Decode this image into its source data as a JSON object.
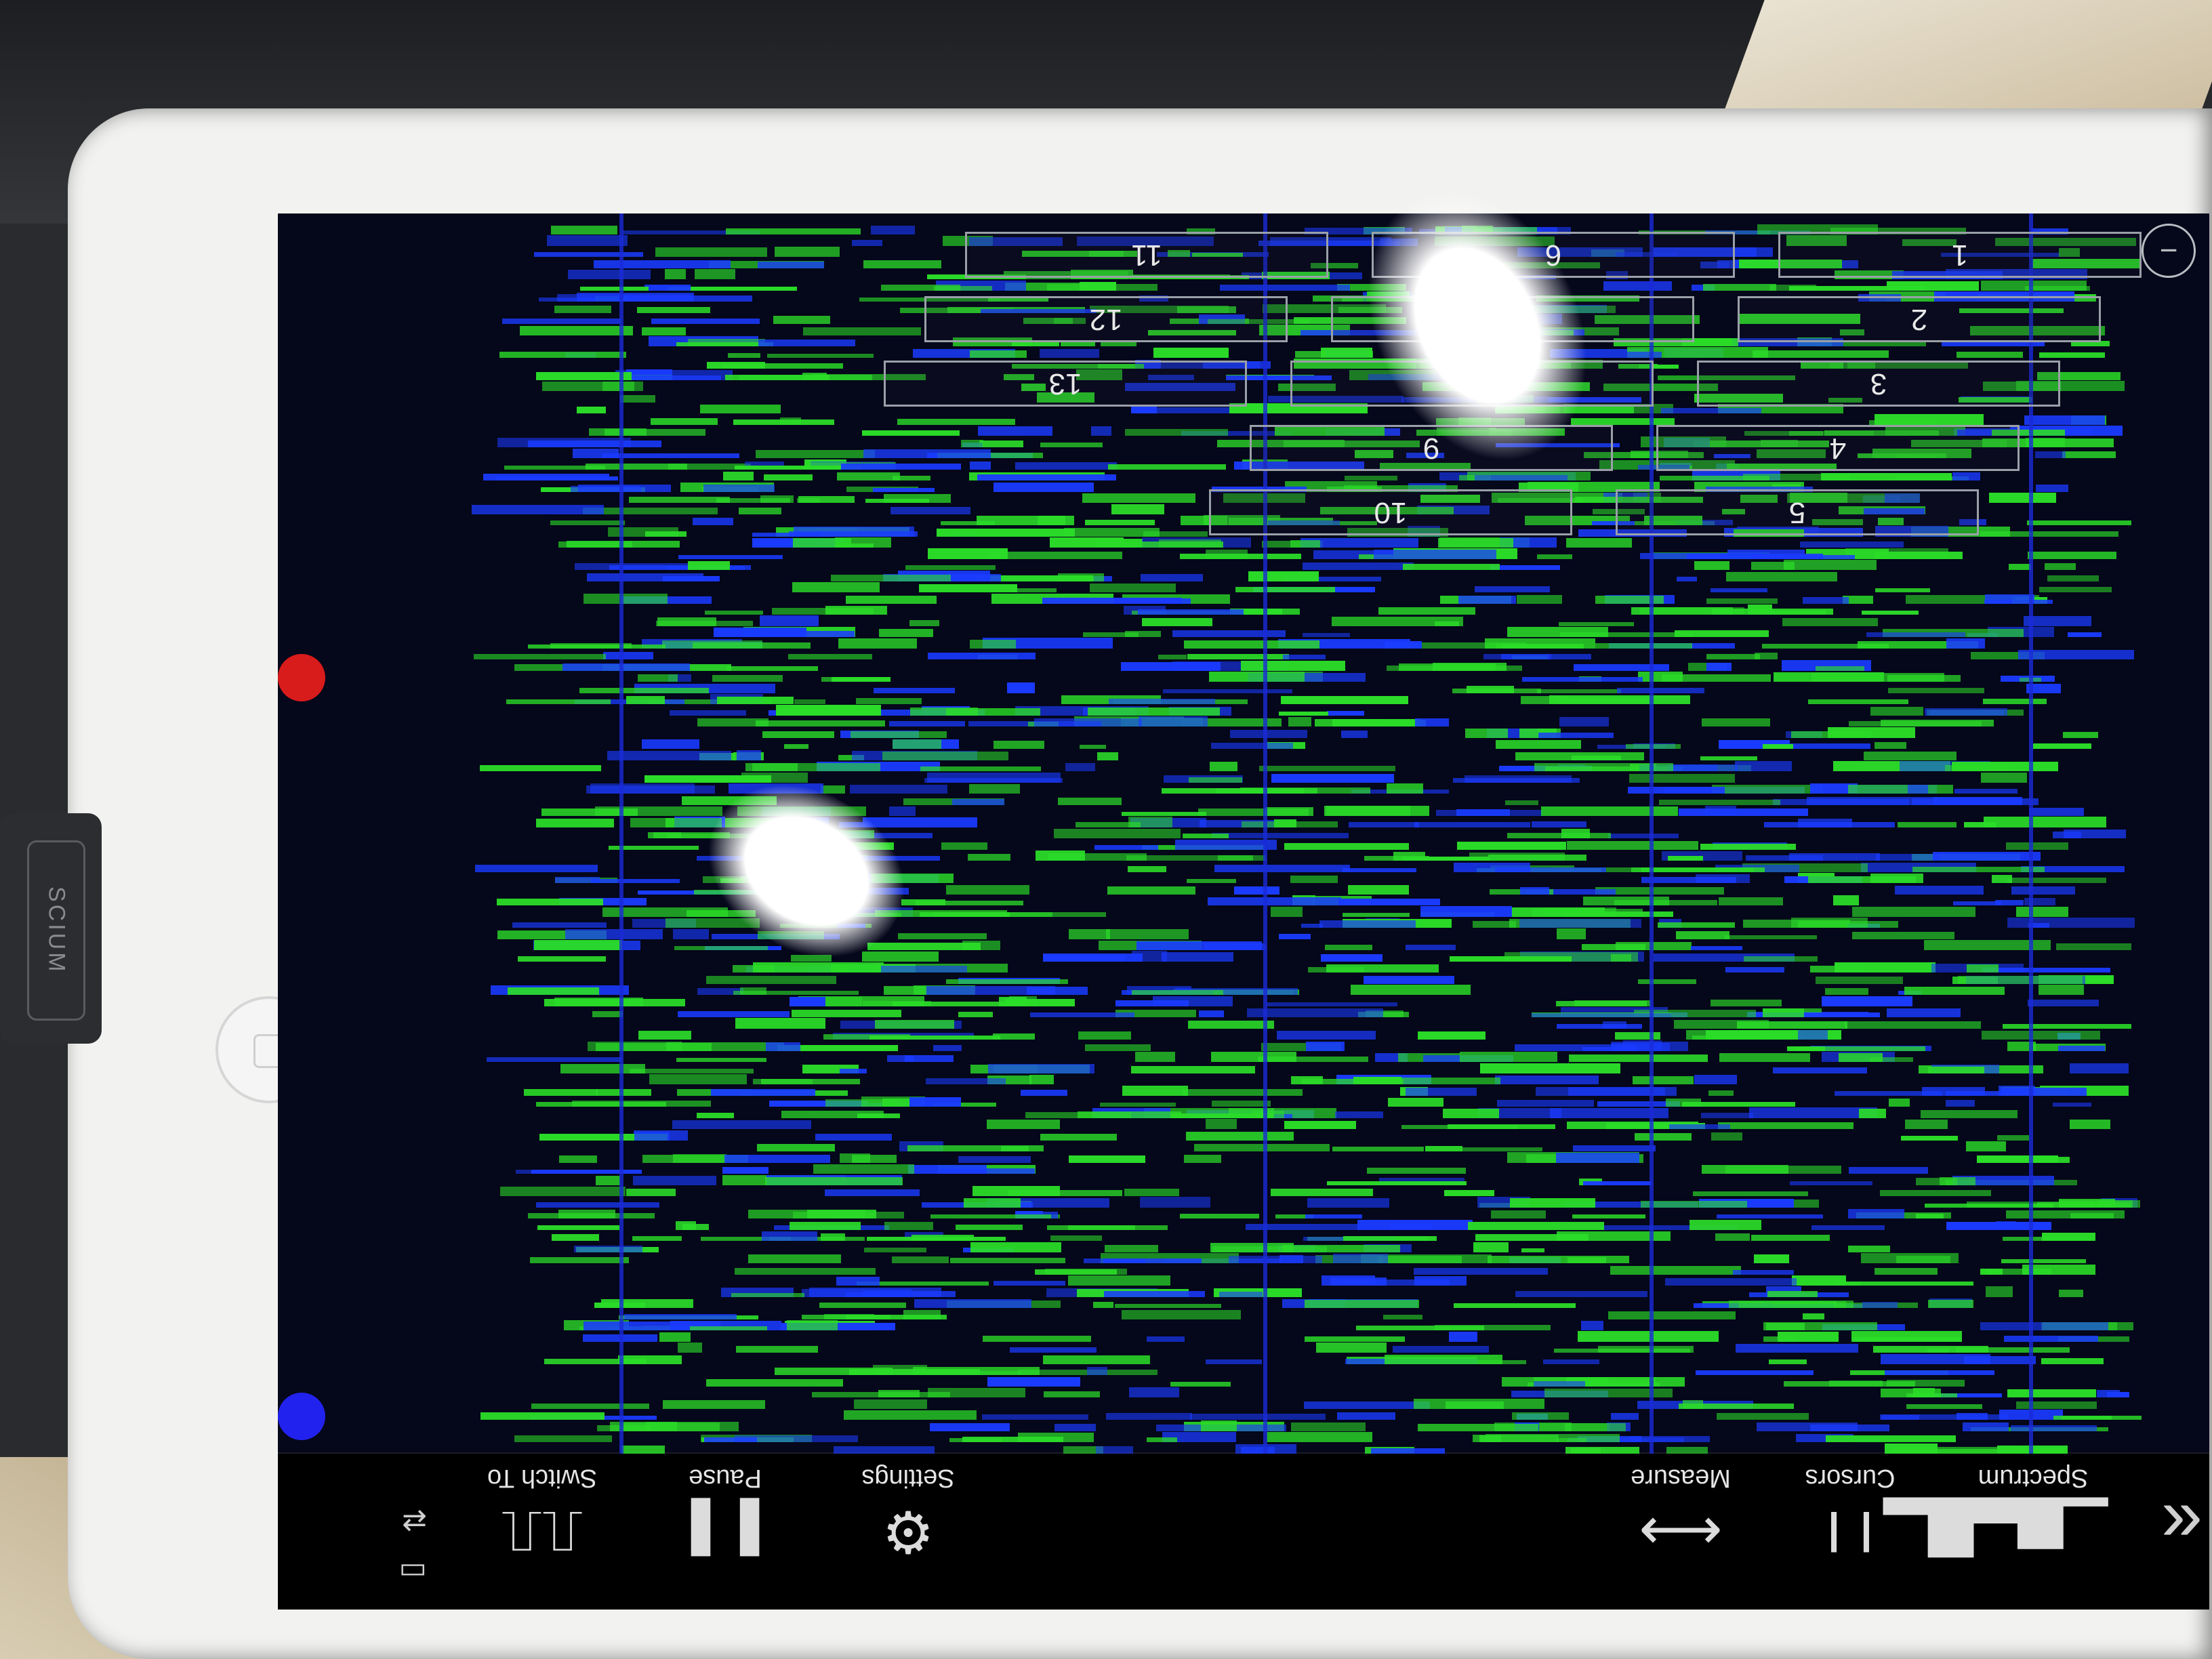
{
  "toolbar": {
    "spectrum": {
      "label": "Spectrum",
      "icon": "spectrum-icon"
    },
    "cursors": {
      "label": "Cursors",
      "icon": "cursors-icon"
    },
    "measure": {
      "label": "Measure",
      "icon": "measure-icon"
    },
    "settings": {
      "label": "Settings",
      "icon": "gear-icon"
    },
    "pause": {
      "label": "Pause",
      "icon": "pause-icon"
    },
    "switch_to": {
      "label": "Switch To",
      "icon": "waveform-icon"
    }
  },
  "channels": [
    "1",
    "2",
    "3",
    "4",
    "5",
    "6",
    "7",
    "8",
    "9",
    "10",
    "11",
    "12",
    "13"
  ],
  "colors": {
    "background": "#05071a",
    "signal_green": "#2bdc28",
    "signal_blue": "#1a3bff",
    "marker_blue": "#2222ee",
    "marker_red": "#d81b1b"
  },
  "device_label": "SCIUM"
}
